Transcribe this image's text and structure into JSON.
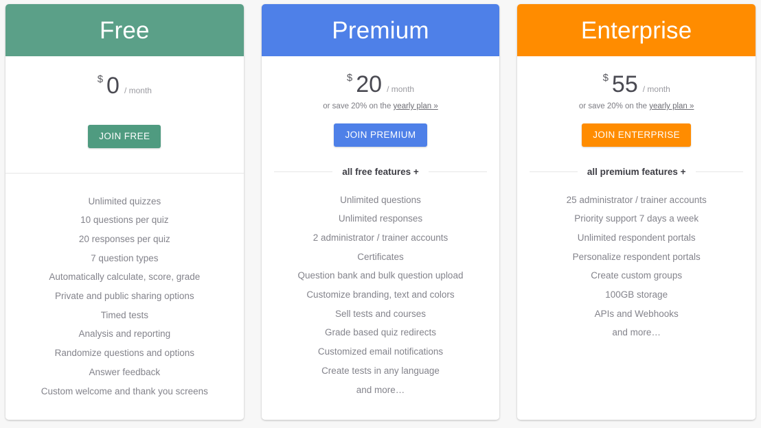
{
  "page": {
    "background_color": "#f7f7f7"
  },
  "plans": [
    {
      "id": "free",
      "name": "Free",
      "header_color": "#5ba088",
      "button_color": "#4f9b80",
      "price": {
        "currency": "$",
        "amount": "0",
        "period": "/ month"
      },
      "save_note": {
        "visible": false,
        "prefix": "",
        "link_label": ""
      },
      "cta_label": "JOIN FREE",
      "divider_label": "",
      "has_divider_label": false,
      "features": [
        "Unlimited quizzes",
        "10 questions per quiz",
        "20 responses per quiz",
        "7 question types",
        "Automatically calculate, score, grade",
        "Private and public sharing options",
        "Timed tests",
        "Analysis and reporting",
        "Randomize questions and options",
        "Answer feedback",
        "Custom welcome and thank you screens"
      ]
    },
    {
      "id": "premium",
      "name": "Premium",
      "header_color": "#4e80e8",
      "button_color": "#4e80e8",
      "price": {
        "currency": "$",
        "amount": "20",
        "period": "/ month"
      },
      "save_note": {
        "visible": true,
        "prefix": "or save 20% on the ",
        "link_label": "yearly plan »"
      },
      "cta_label": "JOIN PREMIUM",
      "divider_label": "all free features +",
      "has_divider_label": true,
      "features": [
        "Unlimited questions",
        "Unlimited responses",
        "2 administrator / trainer accounts",
        "Certificates",
        "Question bank and bulk question upload",
        "Customize branding, text and colors",
        "Sell tests and courses",
        "Grade based quiz redirects",
        "Customized email notifications",
        "Create tests in any language",
        "and more…"
      ]
    },
    {
      "id": "enterprise",
      "name": "Enterprise",
      "header_color": "#ff8c00",
      "button_color": "#ff8c00",
      "price": {
        "currency": "$",
        "amount": "55",
        "period": "/ month"
      },
      "save_note": {
        "visible": true,
        "prefix": "or save 20% on the ",
        "link_label": "yearly plan »"
      },
      "cta_label": "JOIN ENTERPRISE",
      "divider_label": "all premium features +",
      "has_divider_label": true,
      "features": [
        "25 administrator / trainer accounts",
        "Priority support 7 days a week",
        "Unlimited respondent portals",
        "Personalize respondent portals",
        "Create custom groups",
        "100GB storage",
        "APIs and Webhooks",
        "and more…"
      ]
    }
  ]
}
